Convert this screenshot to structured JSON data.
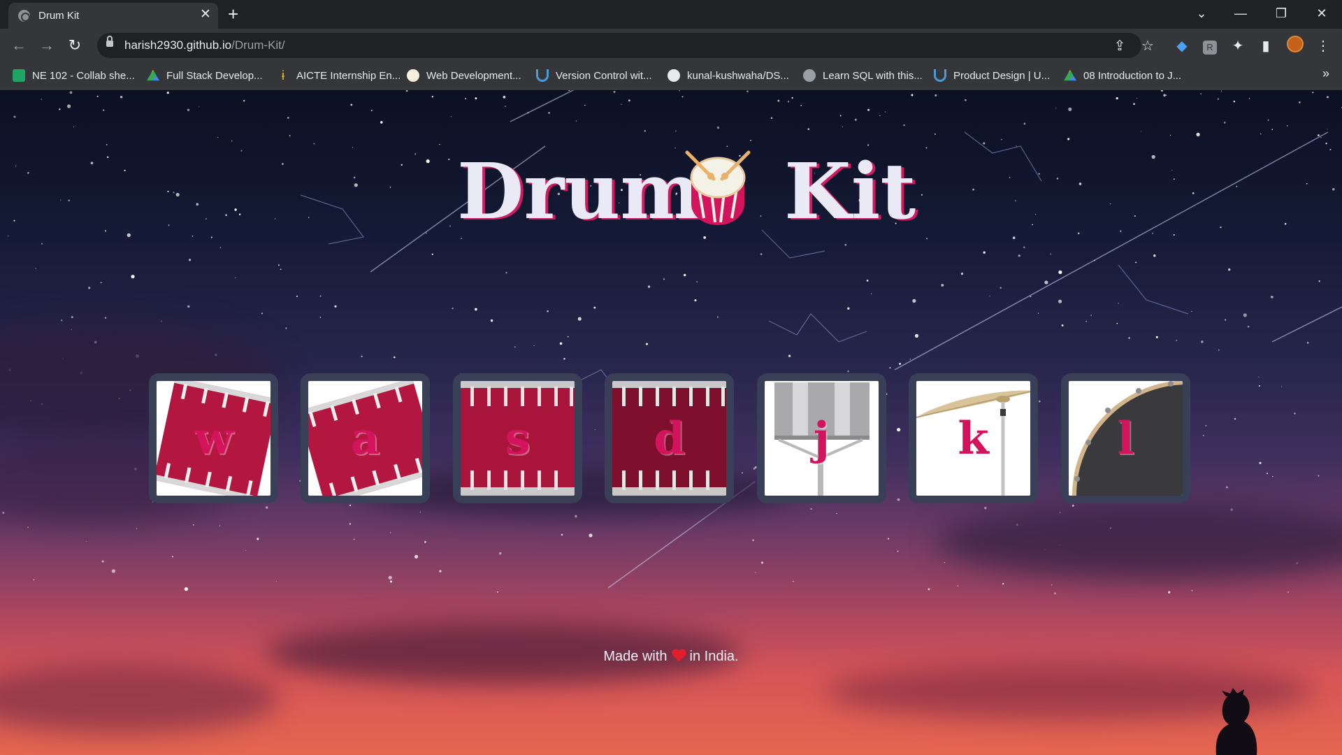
{
  "browser": {
    "tab_title": "Drum Kit",
    "url_host": "harish2930.github.io",
    "url_path": "/Drum-Kit/",
    "bookmarks": [
      {
        "label": "NE 102 - Collab she...",
        "icon": "google-sheets-icon",
        "color": "#1fa463"
      },
      {
        "label": "Full Stack Develop...",
        "icon": "google-drive-icon",
        "color": "#4285f4"
      },
      {
        "label": "AICTE Internship En...",
        "icon": "aicte-icon",
        "color": "#f4c20d"
      },
      {
        "label": "Web Development...",
        "icon": "web-dev-icon",
        "color": "#f6f1dc"
      },
      {
        "label": "Version Control wit...",
        "icon": "udemy-icon",
        "color": "#4a9bd8"
      },
      {
        "label": "kunal-kushwaha/DS...",
        "icon": "github-icon",
        "color": "#e8eaed"
      },
      {
        "label": "Learn SQL with this...",
        "icon": "globe-icon",
        "color": "#9aa0a6"
      },
      {
        "label": "Product Design | U...",
        "icon": "udemy-icon",
        "color": "#4a9bd8"
      },
      {
        "label": "08 Introduction to J...",
        "icon": "google-drive-icon",
        "color": "#4285f4"
      }
    ]
  },
  "page": {
    "title_left": "Drum",
    "title_right": "Kit",
    "title_emoji": "drum-emoji",
    "keys": [
      {
        "letter": "w",
        "sound": "tom-1"
      },
      {
        "letter": "a",
        "sound": "tom-2"
      },
      {
        "letter": "s",
        "sound": "tom-3"
      },
      {
        "letter": "d",
        "sound": "tom-4"
      },
      {
        "letter": "j",
        "sound": "snare"
      },
      {
        "letter": "k",
        "sound": "crash"
      },
      {
        "letter": "l",
        "sound": "kick-bass"
      }
    ],
    "footer": {
      "prefix": "Made with",
      "suffix": "in India."
    }
  },
  "colors": {
    "accent": "#d4135d",
    "title": "#e9eaf6",
    "key_frame": "#3a3f58"
  }
}
